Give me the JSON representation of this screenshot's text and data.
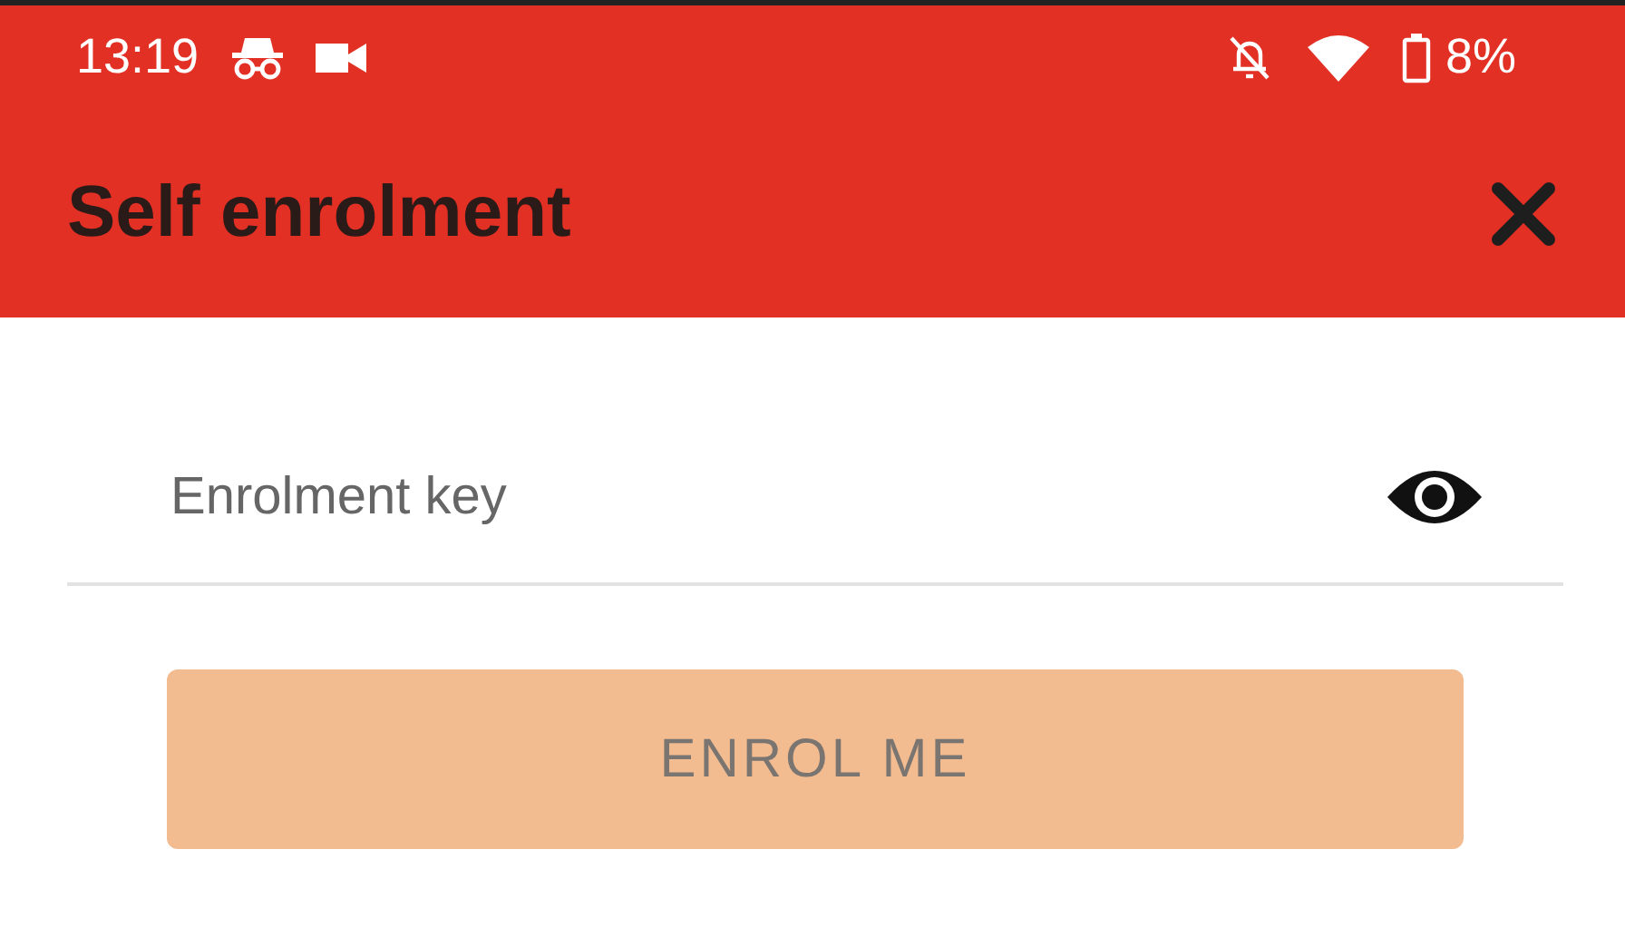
{
  "status_bar": {
    "time": "13:19",
    "battery": "8%"
  },
  "app_bar": {
    "title": "Self enrolment"
  },
  "enrolment_field": {
    "placeholder": "Enrolment key"
  },
  "enrol_button": {
    "label": "ENROL ME",
    "disabled": true
  }
}
